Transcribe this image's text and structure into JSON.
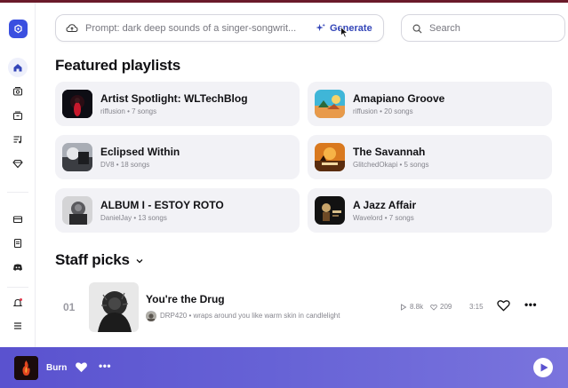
{
  "prompt": {
    "placeholder_text": "Prompt: dark deep sounds of a singer-songwrit...",
    "generate_label": "Generate"
  },
  "search": {
    "placeholder": "Search"
  },
  "featured": {
    "title": "Featured playlists",
    "playlists": [
      {
        "title": "Artist Spotlight: WLTechBlog",
        "meta": "riffusion • 7 songs"
      },
      {
        "title": "Amapiano Groove",
        "meta": "riffusion • 20 songs"
      },
      {
        "title": "Eclipsed Within",
        "meta": "DV8 • 18 songs"
      },
      {
        "title": "The Savannah",
        "meta": "GlitchedOkapi • 5 songs"
      },
      {
        "title": "ALBUM I - ESTOY ROTO",
        "meta": "DanielJay • 13 songs"
      },
      {
        "title": "A Jazz Affair",
        "meta": "Wavelord • 7 songs"
      }
    ]
  },
  "staff_picks": {
    "title": "Staff picks",
    "items": [
      {
        "rank": "01",
        "title": "You're the Drug",
        "artist_line": "DRP420 • wraps around you like warm skin in candlelight",
        "plays": "8.8k",
        "likes": "209",
        "duration": "3:15"
      }
    ]
  },
  "player": {
    "track_title": "Burn"
  },
  "sidebar_icons": [
    "home-icon",
    "radio-icon",
    "library-icon",
    "playlist-icon",
    "gem-icon",
    "subscription-icon",
    "document-icon",
    "discord-icon",
    "notification-icon",
    "menu-icon"
  ],
  "colors": {
    "accent": "#3446b8",
    "logo": "#3a4fe0",
    "player_start": "#5a52cf",
    "player_end": "#7a74dd",
    "card_bg": "#f2f2f6"
  }
}
